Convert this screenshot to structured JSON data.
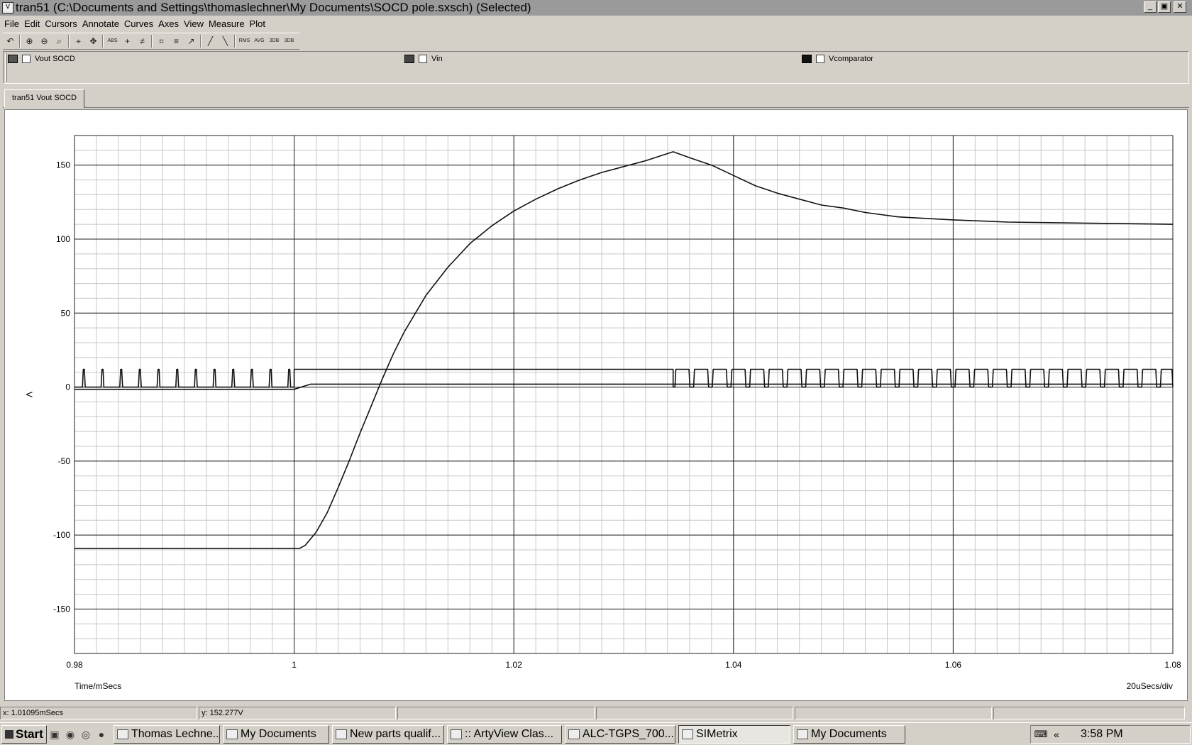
{
  "window": {
    "app_icon_label": "V",
    "title": "tran51 (C:\\Documents and Settings\\thomaslechner\\My Documents\\SOCD pole.sxsch) (Selected)",
    "controls": [
      "_",
      "▣",
      "✕"
    ]
  },
  "menu": [
    "File",
    "Edit",
    "Cursors",
    "Annotate",
    "Curves",
    "Axes",
    "View",
    "Measure",
    "Plot"
  ],
  "toolbar": [
    {
      "icon": "undo-icon",
      "glyph": "↶"
    },
    {
      "icon": "zoom-box-icon",
      "glyph": "⊕"
    },
    {
      "icon": "zoom-out-icon",
      "glyph": "⊖"
    },
    {
      "icon": "zoom-full-icon",
      "glyph": "⌕"
    },
    {
      "icon": "zoom-x-icon",
      "glyph": "⌖"
    },
    {
      "icon": "pan-icon",
      "glyph": "✥"
    },
    {
      "icon": "abs-icon",
      "glyph": "ABS"
    },
    {
      "icon": "cursor-add-icon",
      "glyph": "+"
    },
    {
      "icon": "cursor-remove-icon",
      "glyph": "≠"
    },
    {
      "icon": "grid-icon",
      "glyph": "⌗"
    },
    {
      "icon": "axes-icon",
      "glyph": "≡"
    },
    {
      "icon": "log-axis-icon",
      "glyph": "↗"
    },
    {
      "icon": "rise-icon",
      "glyph": "╱"
    },
    {
      "icon": "fall-icon",
      "glyph": "╲"
    },
    {
      "icon": "rms-icon",
      "glyph": "RMS"
    },
    {
      "icon": "avg-icon",
      "glyph": "AVG"
    },
    {
      "icon": "3db-icon",
      "glyph": "3DB"
    },
    {
      "icon": "3db-low-icon",
      "glyph": "3DB"
    }
  ],
  "legend": [
    {
      "label": "Vout SOCD",
      "color": "#555555"
    },
    {
      "label": "Vin",
      "color": "#444444"
    },
    {
      "label": "Vcomparator",
      "color": "#111111"
    }
  ],
  "tab": {
    "label": "tran51 Vout SOCD"
  },
  "chart_data": {
    "type": "line",
    "xlabel": "Time/mSecs",
    "ylabel": "V",
    "scale_label": "20uSecs/div",
    "xlim": [
      0.98,
      1.08
    ],
    "ylim": [
      -180,
      170
    ],
    "xticks": [
      0.98,
      1,
      1.02,
      1.04,
      1.06,
      1.08
    ],
    "xtick_labels": [
      "0.98",
      "1",
      "1.02",
      "1.04",
      "1.06",
      "1.08"
    ],
    "yticks": [
      150,
      100,
      50,
      0,
      -50,
      -100,
      -150
    ],
    "ytick_labels": [
      "150",
      "100",
      "50",
      "0",
      "-50",
      "-100",
      "-150"
    ],
    "grid": true,
    "series": [
      {
        "name": "Vout SOCD",
        "x": [
          0.98,
          0.99,
          1.0,
          1.0005,
          1.001,
          1.002,
          1.003,
          1.004,
          1.005,
          1.006,
          1.007,
          1.008,
          1.009,
          1.01,
          1.012,
          1.014,
          1.016,
          1.018,
          1.02,
          1.022,
          1.024,
          1.026,
          1.028,
          1.03,
          1.032,
          1.0345,
          1.036,
          1.038,
          1.04,
          1.042,
          1.044,
          1.046,
          1.048,
          1.05,
          1.052,
          1.055,
          1.06,
          1.065,
          1.07,
          1.075,
          1.08
        ],
        "y": [
          -109,
          -109,
          -109,
          -109,
          -107,
          -98,
          -85,
          -68,
          -50,
          -31,
          -13,
          5,
          22,
          37,
          62,
          81,
          97,
          109,
          119,
          127,
          134,
          140,
          145,
          149,
          153,
          159,
          155,
          150,
          143,
          136,
          131,
          127,
          123,
          121,
          118,
          115,
          113,
          111.5,
          111,
          110.5,
          110
        ]
      },
      {
        "name": "Vin",
        "x": [
          0.98,
          1.0,
          1.0015,
          1.08
        ],
        "y": [
          -1.5,
          -1.5,
          2,
          2
        ]
      },
      {
        "name": "Vcomparator",
        "pulse": true,
        "x_start": 0.98,
        "x_end": 1.08,
        "high": 12,
        "low": 0,
        "segments": [
          {
            "from": 0.98,
            "to": 1.0,
            "period": 0.0017,
            "duty": 0.15
          },
          {
            "from": 1.0,
            "to": 1.0345,
            "constant": 12
          },
          {
            "from": 1.0345,
            "to": 1.08,
            "period": 0.0017,
            "duty": 0.8
          }
        ]
      }
    ]
  },
  "status": {
    "x": "x: 1.01095mSecs",
    "y": "y: 152.277V",
    "p3": "",
    "p4": "",
    "p5": "",
    "p6": ""
  },
  "taskbar": {
    "start": "Start",
    "quicklaunch": [
      "▣",
      "◉",
      "◎",
      "●"
    ],
    "tasks": [
      {
        "label": "Thomas Lechne...",
        "active": false
      },
      {
        "label": "My Documents",
        "active": false
      },
      {
        "label": "New parts qualif...",
        "active": false
      },
      {
        "label": ":: ArtyView Clas...",
        "active": false
      },
      {
        "label": "ALC-TGPS_700...",
        "active": false
      },
      {
        "label": "SIMetrix",
        "active": true
      },
      {
        "label": "My Documents",
        "active": false
      }
    ],
    "tray_keyboard": "⌨",
    "tray_chevron": "«",
    "clock": "3:58 PM"
  }
}
